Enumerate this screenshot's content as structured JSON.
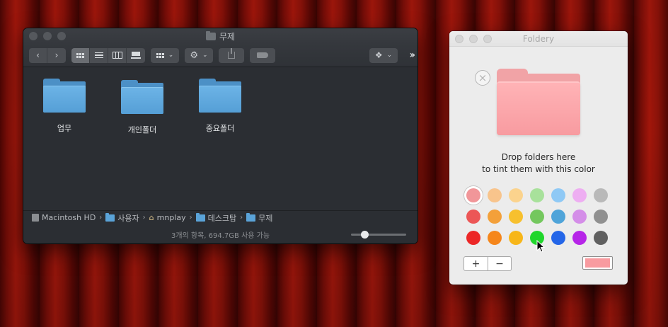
{
  "finder": {
    "title": "무제",
    "items": [
      {
        "label": "업무"
      },
      {
        "label": "개인폴더"
      },
      {
        "label": "중요폴더"
      }
    ],
    "path": [
      {
        "label": "Macintosh HD",
        "icon": "hard-drive-icon"
      },
      {
        "label": "사용자",
        "icon": "folder-icon"
      },
      {
        "label": "mnplay",
        "icon": "home-icon"
      },
      {
        "label": "데스크탑",
        "icon": "folder-icon"
      },
      {
        "label": "무제",
        "icon": "folder-icon"
      }
    ],
    "status": "3개의 항목, 694.7GB 사용 가능",
    "folder_color": "#5aa3d8"
  },
  "foldery": {
    "title": "Foldery",
    "drop_line1": "Drop folders here",
    "drop_line2": "to tint them with this color",
    "selected_color": "#f89ba0",
    "swatch_rows": [
      [
        "#f19699",
        "#f8c48c",
        "#fbd38d",
        "#a8e19b",
        "#8fc9f5",
        "#eeaef2",
        "#b9b9b9"
      ],
      [
        "#ec5656",
        "#f3a03a",
        "#f7c02e",
        "#74c75e",
        "#4fa4d9",
        "#d48ee8",
        "#909090"
      ],
      [
        "#ec2727",
        "#f5861b",
        "#f7b619",
        "#1fd62b",
        "#2466e8",
        "#b625e8",
        "#606060"
      ]
    ],
    "plus_label": "+",
    "minus_label": "−"
  }
}
